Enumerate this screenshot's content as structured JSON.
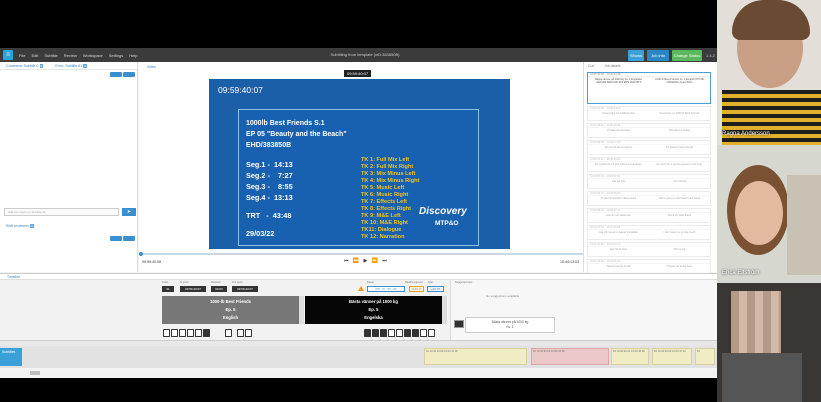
{
  "window": {
    "title": "Subtitling from template (xID:383850B)",
    "menu": [
      "File",
      "Edit",
      "Subtitle",
      "Review",
      "Workspace",
      "Settings",
      "Help"
    ],
    "top_buttons": [
      "Shows",
      "Job info",
      "Change Status"
    ],
    "version": "1.4.2"
  },
  "left_panel": {
    "tab1": "Comment: Subtitle 0",
    "tab1_count": "0",
    "tab2": "Error: Subtitle 61",
    "tab2_count": "0",
    "input_placeholder": "Add comment on Subtitle 61",
    "sub_label": "Shift reviewers",
    "sub_count": "0"
  },
  "video": {
    "panel_label": "Video",
    "top_timecode": "09:59:40:07",
    "frame_timecode": "09:59:40:07",
    "slate": {
      "title": "1000lb Best Friends S.1",
      "episode": "EP 05 \"Beauty and the Beach\"",
      "code": "EHD/383850B",
      "segments": [
        "Seg.1 -  14:13",
        "Seg.2 -    7:27",
        "Seg.3 -    8:55",
        "Seg.4 -  13:13"
      ],
      "trt": "TRT   -  43:48",
      "date": "29/03/22",
      "tracks": [
        "TK 1: Full Mix Left",
        "TK 2: Full Mix Right",
        "TK 3: Mix Minus Left",
        "TK 4: Mix Minus Right",
        "TK 5: Music Left",
        "TK 6: Music Right",
        "TK 7: Effects Left",
        "TK 8: Effects Right",
        "TK 9: M&E Left",
        "TK 10: M&E Right",
        "TK11: Dialogue",
        "TK 12: Narration"
      ],
      "brand": "Discovery",
      "brand_sub": "MTP&O"
    },
    "tc_left": "09:59:40:08",
    "tc_right": "10:44:13:03",
    "transport_icons": "⏮ ⏪ ▶ ⏩ ⏭",
    "scrub_progress": 0.0
  },
  "right_panel": {
    "tabs": [
      "Cue",
      "Job details"
    ],
    "cues": [
      {
        "head": "10:00:40:08 – 10:00:41:08",
        "left": "Bästa vänner på 1000 kg Sv. 1 Engelska HÄRVAR SEKUND 9FS EPS 2022 BTS",
        "right": "1000 lb Best Friends Sv. 1 English XTOTE CRAWAR Lovers Bros",
        "active": true
      },
      {
        "head": "10:00:41:09 – 10:00:43:00",
        "left": "Ursprunglig tid: 1000 kg skur",
        "right": "Previously on 1000 lb Best Friends",
        "active": false
      },
      {
        "head": "10:00:43:01 – 10:00:45:08",
        "left": "Vi hade lite kul idag!",
        "right": "We had fun today!",
        "active": false
      },
      {
        "head": "10:00:45:09 – 10:00:47:20",
        "left": "Det är bra att ha vänner",
        "right": "It's good to have friends",
        "active": false
      },
      {
        "head": "10:00:47:21 – 10:00:50:02",
        "left": "Så mycket för ett gott syfte att leva länge.",
        "right": "So much for a good purpose to live long.",
        "active": false
      },
      {
        "head": "10:00:50:03 – 10:00:52:11",
        "left": "Jag vet inte",
        "right": "I don't know",
        "active": false
      },
      {
        "head": "10:00:52:12 – 10:00:55:00",
        "left": "Vi ska till stranden nästa vecka",
        "right": "We're going to the beach next week",
        "active": false
      },
      {
        "head": "10:00:55:01 – 10:00:57:17",
        "left": "Hon är min bästa vän",
        "right": "She's my best friend",
        "active": false
      },
      {
        "head": "10:00:57:18 – 10:01:00:04",
        "left": "Jag vill inte att vi tappar kontakten",
        "right": "I don't want us to lose touch",
        "active": false
      },
      {
        "head": "10:01:00:05 – 10:01:02:22",
        "left": "Det här är stort",
        "right": "This is big",
        "active": false
      },
      {
        "head": "10:01:02:23 – 10:01:05:10",
        "left": "Tack för att du är här",
        "right": "Thanks for being here",
        "active": false
      }
    ]
  },
  "timeline": {
    "label": "Timeline",
    "fields": [
      {
        "label": "Index",
        "value": "61"
      },
      {
        "label": "In point",
        "value": "09:59:40:07"
      },
      {
        "label": "Duration",
        "value": "00:00"
      },
      {
        "label": "Out point",
        "value": "09:59:40:07"
      }
    ],
    "original": {
      "line1": "1000-lb Best Friends",
      "line2": "Ep. 5",
      "line3": "English"
    },
    "translation": {
      "line1": "Bästa vänner på 1000 kg",
      "line2": "Ep. 5",
      "line3": "Engelska"
    },
    "trans_fields": [
      {
        "label": "Dauer",
        "value": "(00 : 0) : 00 : 00"
      },
      {
        "label": "Reading speed",
        "value": "0.0 / 0"
      },
      {
        "label": "Gap",
        "value": "+00:07"
      }
    ],
    "suggest_title": "Suggested text",
    "suggest_empty": "No suggestions available",
    "suggest_line1": "Bästa vänner på 1000 kg",
    "suggest_line2": "Sv. 1",
    "track_label": "Subtitles",
    "clips": [
      {
        "text": "61 10:00:40:08 10:00:41:08",
        "kind": "y"
      },
      {
        "text": "62 10:00:41:09 10:00:43:00",
        "kind": "p"
      },
      {
        "text": "63 10:00:43:01 10:00:45:08",
        "kind": "y"
      },
      {
        "text": "64 10:00:45:09 10:00:47:20",
        "kind": "y"
      },
      {
        "text": "65",
        "kind": "y"
      }
    ]
  },
  "video_call": {
    "participants": [
      "Ragna Andersson",
      "Erica Elfström",
      ""
    ]
  }
}
